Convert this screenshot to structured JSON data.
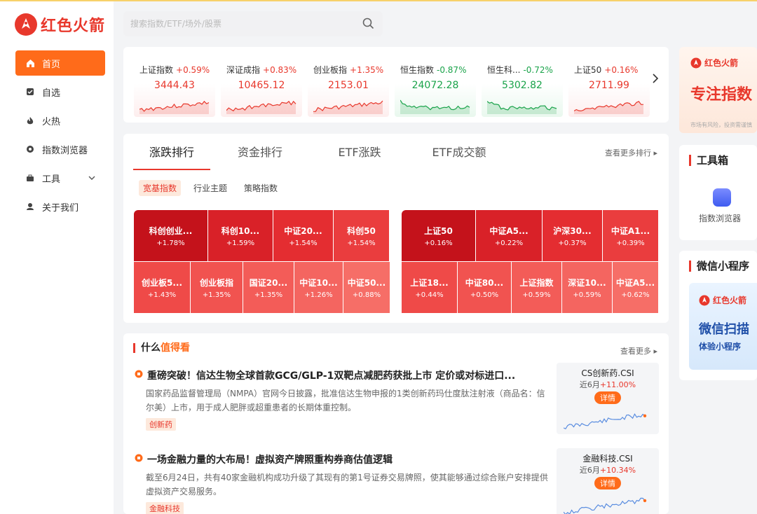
{
  "brand": {
    "name": "红色火箭"
  },
  "search": {
    "placeholder": "搜索指数/ETF/场外/股票"
  },
  "nav": [
    {
      "label": "首页",
      "icon": "home-icon"
    },
    {
      "label": "自选",
      "icon": "star-box-icon"
    },
    {
      "label": "火热",
      "icon": "fire-icon"
    },
    {
      "label": "指数浏览器",
      "icon": "browser-icon"
    },
    {
      "label": "工具",
      "icon": "toolbox-icon"
    },
    {
      "label": "关于我们",
      "icon": "about-icon"
    }
  ],
  "indices": [
    {
      "name": "上证指数",
      "change": "+0.59%",
      "value": "3444.43",
      "trend": "up"
    },
    {
      "name": "深证成指",
      "change": "+0.83%",
      "value": "10465.12",
      "trend": "up"
    },
    {
      "name": "创业板指",
      "change": "+1.35%",
      "value": "2153.01",
      "trend": "up"
    },
    {
      "name": "恒生指数",
      "change": "-0.87%",
      "value": "24072.28",
      "trend": "down"
    },
    {
      "name": "恒生科...",
      "change": "-0.72%",
      "value": "5302.82",
      "trend": "down"
    },
    {
      "name": "上证50",
      "change": "+0.16%",
      "value": "2711.99",
      "trend": "up"
    }
  ],
  "ranking": {
    "tabs": [
      "涨跌排行",
      "资金排行",
      "ETF涨跌",
      "ETF成交额"
    ],
    "more": "查看更多排行",
    "subtabs": [
      "宽基指数",
      "行业主题",
      "策略指数"
    ],
    "left": [
      {
        "name": "科创创业...",
        "change": "+1.78%"
      },
      {
        "name": "科创10...",
        "change": "+1.59%"
      },
      {
        "name": "中证20...",
        "change": "+1.54%"
      },
      {
        "name": "科创50",
        "change": "+1.54%"
      },
      {
        "name": "创业板5...",
        "change": "+1.43%"
      },
      {
        "name": "创业板指",
        "change": "+1.35%"
      },
      {
        "name": "国证20...",
        "change": "+1.35%"
      },
      {
        "name": "中证10...",
        "change": "+1.26%"
      },
      {
        "name": "中证50...",
        "change": "+0.88%"
      }
    ],
    "right": [
      {
        "name": "上证50",
        "change": "+0.16%"
      },
      {
        "name": "中证A5...",
        "change": "+0.22%"
      },
      {
        "name": "沪深30...",
        "change": "+0.37%"
      },
      {
        "name": "中证A1...",
        "change": "+0.39%"
      },
      {
        "name": "上证18...",
        "change": "+0.44%"
      },
      {
        "name": "中证80...",
        "change": "+0.50%"
      },
      {
        "name": "上证指数",
        "change": "+0.59%"
      },
      {
        "name": "深证10...",
        "change": "+0.59%"
      },
      {
        "name": "中证A5...",
        "change": "+0.62%"
      }
    ]
  },
  "news": {
    "title_prefix": "什么",
    "title_highlight": "值得看",
    "more": "查看更多",
    "items": [
      {
        "headline": "重磅突破！信达生物全球首款GCG/GLP-1双靶点减肥药获批上市 定价或对标进口...",
        "desc": "国家药品监督管理局（NMPA）官网今日披露，批准信达生物申报的1类创新药玛仕度肽注射液（商品名：信尔美）上市，用于成人肥胖或超重患者的长期体重控制。",
        "tag": "创新药",
        "index_name": "CS创新药.CSI",
        "period": "近6月",
        "perf": "+11.00%",
        "button": "详情"
      },
      {
        "headline": "一场金融力量的大布局！虚拟资产牌照重构券商估值逻辑",
        "desc": "截至6月24日，共有40家金融机构成功升级了其现有的第1号证券交易牌照，使其能够通过综合账户安排提供虚拟资产交易服务。",
        "tag": "金融科技",
        "index_name": "金融科技.CSI",
        "period": "近6月",
        "perf": "+10.34%",
        "button": "详情"
      }
    ]
  },
  "right": {
    "banner_brand": "红色火箭",
    "banner_slogan": "专注指数",
    "banner_note": "市场有风险，投资需谨慎",
    "tools_title": "工具箱",
    "tool_label": "指数浏览器",
    "wechat_title": "微信小程序",
    "wechat_brand": "红色火箭",
    "wechat_scan": "微信扫描",
    "wechat_sub": "体验小程序"
  },
  "colors": {
    "accent": "#ff6b1a",
    "up": "#e8382c",
    "down": "#1aa34a"
  }
}
